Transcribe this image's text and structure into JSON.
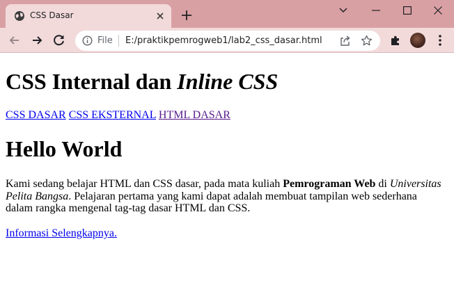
{
  "browser": {
    "tab_title": "CSS Dasar",
    "omnibox_scheme_label": "File",
    "url": "E:/praktikpemrogweb1/lab2_css_dasar.html"
  },
  "page": {
    "heading_prefix": "CSS Internal dan ",
    "heading_italic": "Inline CSS",
    "nav_links": [
      {
        "label": "CSS DASAR"
      },
      {
        "label": "CSS EKSTERNAL"
      },
      {
        "label": "HTML DASAR"
      }
    ],
    "hello": "Hello World",
    "paragraph": {
      "part1": "Kami sedang belajar HTML dan CSS dasar, pada mata kuliah ",
      "bold": "Pemrograman Web",
      "part2": " di ",
      "italic": "Universitas Pelita Bangsa",
      "part3": ". Pelajaran pertama yang kami dapat adalah membuat tampilan web sederhana dalam rangka mengenal tag-tag dasar HTML dan CSS."
    },
    "more_link": "Informasi Selengkapnya."
  }
}
